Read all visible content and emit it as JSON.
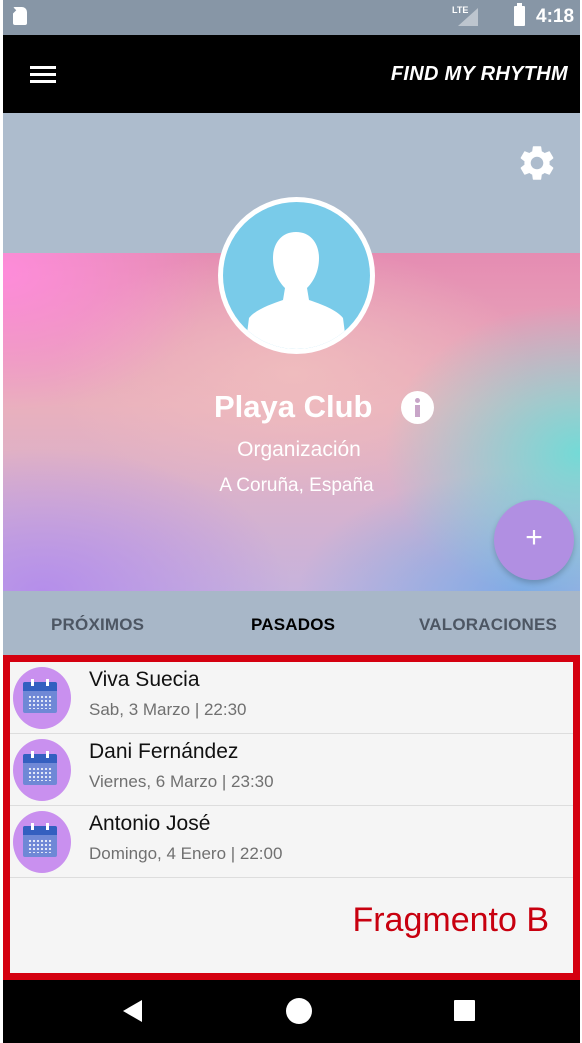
{
  "status_bar": {
    "network": "LTE",
    "time": "4:18"
  },
  "app_bar": {
    "title": "FIND MY RHYTHM"
  },
  "profile": {
    "name": "Playa Club",
    "type": "Organización",
    "location": "A Coruña, España"
  },
  "fab": {
    "label": "+"
  },
  "tabs": [
    {
      "label": "PRÓXIMOS",
      "active": false
    },
    {
      "label": "PASADOS",
      "active": true
    },
    {
      "label": "VALORACIONES",
      "active": false
    }
  ],
  "events": [
    {
      "title": "Viva Suecia",
      "date": "Sab, 3 Marzo | 22:30",
      "icon": "calendar-icon"
    },
    {
      "title": "Dani Fernández",
      "date": "Viernes, 6 Marzo | 23:30",
      "icon": "calendar-icon"
    },
    {
      "title": "Antonio José",
      "date": "Domingo, 4 Enero | 22:00",
      "icon": "calendar-icon"
    }
  ],
  "fragment_label": "Fragmento B",
  "colors": {
    "header_bg": "#adbccd",
    "fab": "#b18fe2",
    "fragment_border": "#d40010",
    "event_avatar": "#c990ef"
  }
}
